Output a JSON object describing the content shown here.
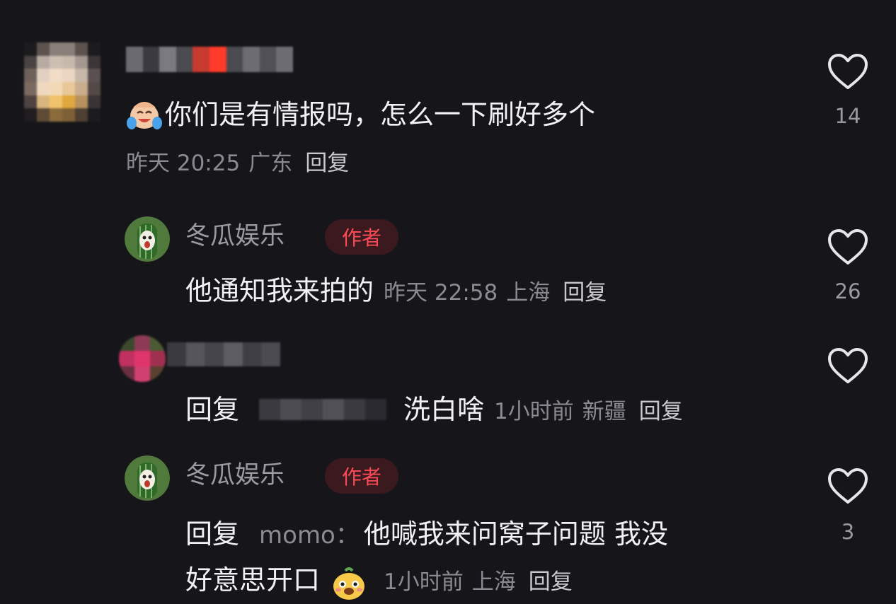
{
  "colors": {
    "background": "#16161a",
    "author_badge_text": "#fb4b55",
    "author_badge_bg": "#3a1a1f",
    "meta_text": "#8a8a90"
  },
  "comments": [
    {
      "avatar_icon": "blurred-avatar",
      "username": "",
      "emoji_icon": "crying-laughing-emoji",
      "text": "你们是有情报吗，怎么一下刷好多个",
      "time": "昨天 20:25",
      "location": "广东",
      "reply_label": "回复",
      "likes": "14"
    },
    {
      "avatar_icon": "winter-melon-avatar",
      "username": "冬瓜娱乐",
      "badge": "作者",
      "text": "他通知我来拍的",
      "time": "昨天 22:58",
      "location": "上海",
      "reply_label": "回复",
      "likes": "26"
    },
    {
      "avatar_icon": "blurred-avatar",
      "username": "",
      "prefix": "回复",
      "text": "洗白啥",
      "time": "1小时前",
      "location": "新疆",
      "reply_label": "回复",
      "likes": ""
    },
    {
      "avatar_icon": "winter-melon-avatar",
      "username": "冬瓜娱乐",
      "badge": "作者",
      "prefix": "回复",
      "mention": "momo：",
      "text_line1": "他喊我来问窝子问题 我没",
      "text_line2": "好意思开口",
      "emoji_icon": "dog-face-emoji",
      "time": "1小时前",
      "location": "上海",
      "reply_label": "回复",
      "likes": "3"
    }
  ]
}
